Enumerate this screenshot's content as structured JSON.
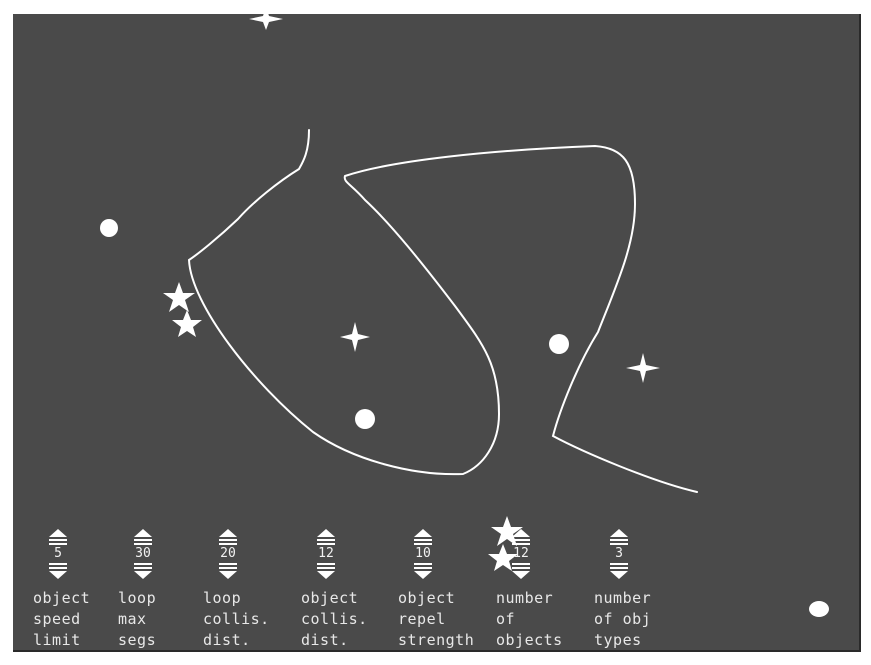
{
  "colors": {
    "background": "#4a4a4a",
    "foreground": "#ffffff",
    "text": "#e8e8e8"
  },
  "controls": [
    {
      "value": "5",
      "label": [
        "object",
        "speed",
        "limit"
      ]
    },
    {
      "value": "30",
      "label": [
        "loop",
        "max",
        "segs"
      ]
    },
    {
      "value": "20",
      "label": [
        "loop",
        "collis.",
        "dist."
      ]
    },
    {
      "value": "12",
      "label": [
        "object",
        "collis.",
        "dist."
      ]
    },
    {
      "value": "10",
      "label": [
        "object",
        "repel",
        "strength"
      ]
    },
    {
      "value": "12",
      "label": [
        "number",
        "of",
        "objects"
      ]
    },
    {
      "value": "3",
      "label": [
        "number",
        "of obj",
        "types"
      ]
    }
  ]
}
